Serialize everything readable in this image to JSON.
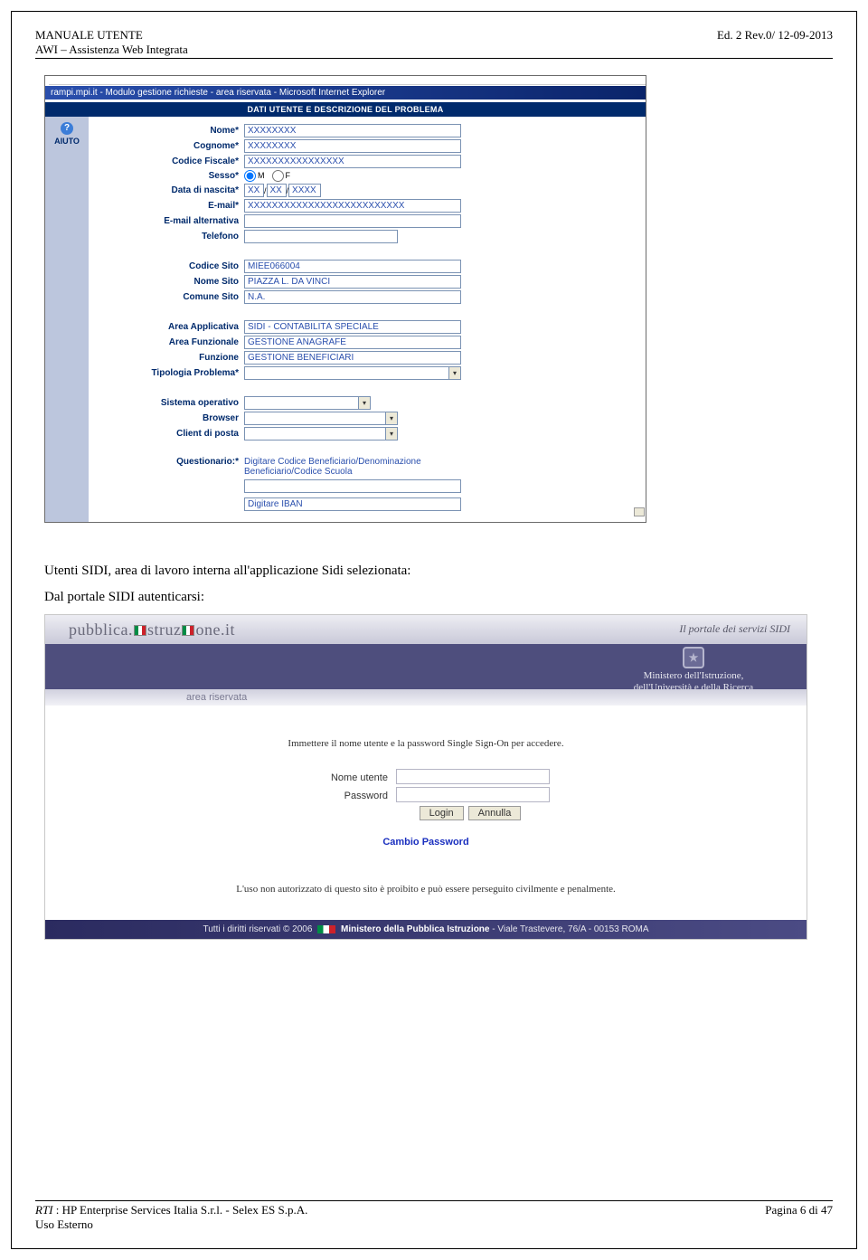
{
  "header": {
    "title1": "MANUALE UTENTE",
    "title2": "AWI – Assistenza Web Integrata",
    "edition": "Ed. 2 Rev.0/ 12-09-2013"
  },
  "screenshot1": {
    "window_title": "rampi.mpi.it - Modulo gestione richieste - area riservata - Microsoft Internet Explorer",
    "section_title": "DATI UTENTE E DESCRIZIONE DEL PROBLEMA",
    "aiuto_label": "AIUTO",
    "fields": {
      "nome": {
        "label": "Nome*",
        "value": "XXXXXXXX"
      },
      "cognome": {
        "label": "Cognome*",
        "value": "XXXXXXXX"
      },
      "codice_fiscale": {
        "label": "Codice Fiscale*",
        "value": "XXXXXXXXXXXXXXXX"
      },
      "sesso": {
        "label": "Sesso*",
        "m": "M",
        "f": "F"
      },
      "data_nascita": {
        "label": "Data di nascita*",
        "d": "XX",
        "m": "XX",
        "y": "XXXX"
      },
      "email": {
        "label": "E-mail*",
        "value": "XXXXXXXXXXXXXXXXXXXXXXXXXX"
      },
      "email_alt": {
        "label": "E-mail alternativa",
        "value": ""
      },
      "telefono": {
        "label": "Telefono",
        "value": ""
      },
      "codice_sito": {
        "label": "Codice Sito",
        "value": "MIEE066004"
      },
      "nome_sito": {
        "label": "Nome Sito",
        "value": "PIAZZA L. DA VINCI"
      },
      "comune_sito": {
        "label": "Comune Sito",
        "value": "N.A."
      },
      "area_applicativa": {
        "label": "Area Applicativa",
        "value": "SIDI - CONTABILITÀ SPECIALE"
      },
      "area_funzionale": {
        "label": "Area Funzionale",
        "value": "GESTIONE ANAGRAFE"
      },
      "funzione": {
        "label": "Funzione",
        "value": "GESTIONE BENEFICIARI"
      },
      "tipologia": {
        "label": "Tipologia Problema*",
        "value": ""
      },
      "sistema_operativo": {
        "label": "Sistema operativo",
        "value": ""
      },
      "browser": {
        "label": "Browser",
        "value": ""
      },
      "client_posta": {
        "label": "Client di posta",
        "value": ""
      },
      "questionario": {
        "label": "Questionario:*",
        "line1": "Digitare    Codice    Beneficiario/Denominazione",
        "line2": "Beneficiario/Codice Scuola",
        "iban": "Digitare IBAN"
      }
    }
  },
  "paragraphs": {
    "p1": "Utenti SIDI, area di lavoro interna all'applicazione Sidi selezionata:",
    "p2": "Dal portale SIDI autenticarsi:"
  },
  "screenshot2": {
    "brand_1": "pubblica.",
    "brand_2": "struz",
    "brand_3": "one",
    "brand_suffix": ".it",
    "tagline": "Il portale dei servizi SIDI",
    "crest_line1": "Ministero dell'Istruzione,",
    "crest_line2": "dell'Università e della Ricerca",
    "area_label": "area riservata",
    "instruction": "Immettere il nome utente e la password Single Sign-On per accedere.",
    "login": {
      "user_label": "Nome utente",
      "pass_label": "Password",
      "login_btn": "Login",
      "cancel_btn": "Annulla",
      "change_pwd": "Cambio Password"
    },
    "warning": "L'uso non autorizzato di questo sito è proibito e può essere perseguito civilmente e penalmente.",
    "footer_left": "Tutti i diritti riservati © 2006",
    "footer_brand": "Ministero della Pubblica Istruzione",
    "footer_addr": " - Viale Trastevere, 76/A - 00153 ROMA"
  },
  "footer": {
    "rti_prefix": "RTI",
    "rti_rest": " : HP Enterprise Services Italia S.r.l. - Selex ES S.p.A.",
    "line2": "Uso Esterno",
    "page": "Pagina 6 di 47"
  }
}
